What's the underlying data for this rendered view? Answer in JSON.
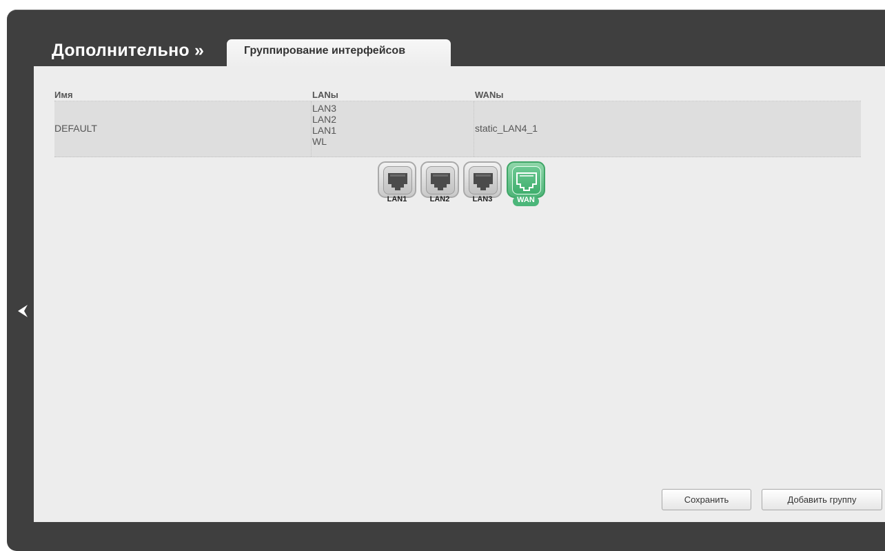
{
  "header": {
    "section_title": "Дополнительно »",
    "active_tab": "Группирование интерфейсов"
  },
  "table": {
    "columns": [
      "Имя",
      "LANы",
      "WANы"
    ],
    "rows": [
      {
        "name": "DEFAULT",
        "lans": [
          "LAN3",
          "LAN2",
          "LAN1",
          "WL"
        ],
        "wans": "static_LAN4_1"
      }
    ]
  },
  "ports": [
    {
      "label": "LAN1",
      "state": "inactive"
    },
    {
      "label": "LAN2",
      "state": "inactive"
    },
    {
      "label": "LAN3",
      "state": "inactive"
    },
    {
      "label": "WAN",
      "state": "active"
    }
  ],
  "buttons": {
    "save": "Сохранить",
    "add_group": "Добавить группу"
  },
  "icons": {
    "back": "back-arrow-icon",
    "port": "ethernet-port-icon"
  },
  "colors": {
    "frame": "#3f3f3f",
    "panel": "#ededed",
    "row": "#dedede",
    "wan_active": "#4cb67a"
  }
}
